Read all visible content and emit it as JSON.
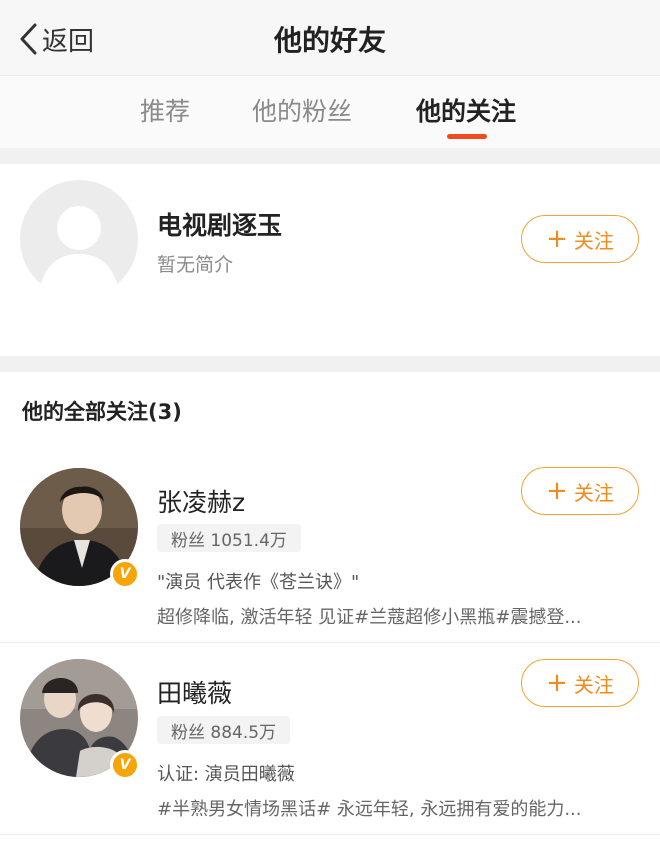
{
  "header": {
    "back_label": "返回",
    "title": "他的好友"
  },
  "tabs": [
    {
      "label": "推荐",
      "active": false
    },
    {
      "label": "他的粉丝",
      "active": false
    },
    {
      "label": "他的关注",
      "active": true
    }
  ],
  "colors": {
    "accent": "#f04a1e",
    "follow": "#f08c1c",
    "badge": "#f5a40a"
  },
  "featured": {
    "name": "电视剧逐玉",
    "bio": "暂无简介",
    "follow_label": "关注",
    "avatar": "default-avatar-icon"
  },
  "following_section": {
    "title": "他的全部关注(3)"
  },
  "users": [
    {
      "name": "张凌赫z",
      "fans": "粉丝 1051.4万",
      "intro": "\"演员 代表作《苍兰诀》\"",
      "recent": "超修降临, 激活年轻 见证#兰蔻超修小黑瓶#震撼登...",
      "follow_label": "关注",
      "verified_icon": "verified-v-icon"
    },
    {
      "name": "田曦薇",
      "fans": "粉丝 884.5万",
      "intro": "认证: 演员田曦薇",
      "recent": "#半熟男女情场黑话# 永远年轻, 永远拥有爱的能力...",
      "follow_label": "关注",
      "verified_icon": "verified-v-icon"
    }
  ]
}
